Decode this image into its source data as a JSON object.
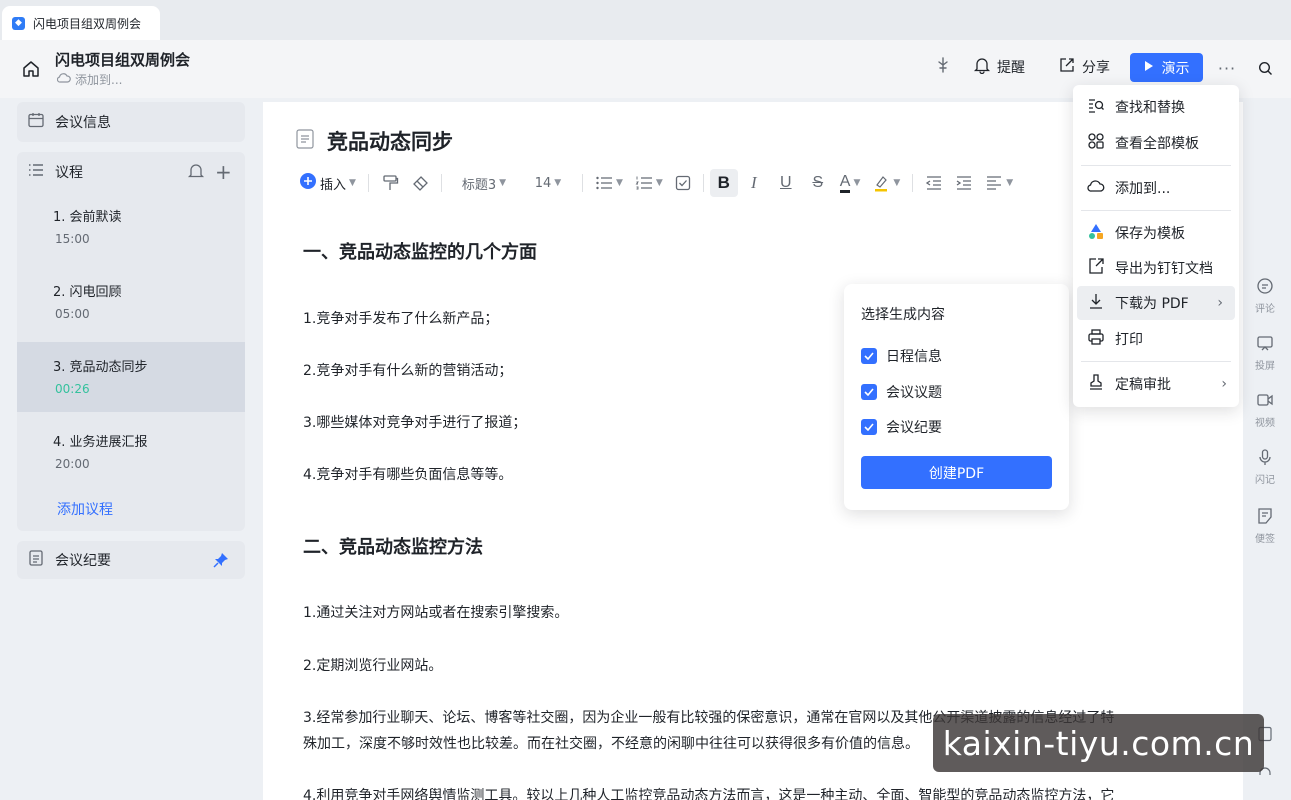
{
  "tab": {
    "title": "闪电项目组双周例会"
  },
  "header": {
    "title": "闪电项目组双周例会",
    "add_to": "添加到...",
    "remind_label": "提醒",
    "share_label": "分享",
    "present_label": "演示",
    "more_label": "···"
  },
  "sidebar": {
    "meeting_info": "会议信息",
    "agenda_title": "议程",
    "agenda": [
      {
        "label": "1. 会前默读",
        "duration": "15:00"
      },
      {
        "label": "2. 闪电回顾",
        "duration": "05:00"
      },
      {
        "label": "3. 竞品动态同步",
        "duration": "00:26",
        "active": true
      },
      {
        "label": "4. 业务进展汇报",
        "duration": "20:00"
      }
    ],
    "add_agenda": "添加议程",
    "minutes": "会议纪要"
  },
  "document": {
    "title": "竞品动态同步",
    "toolbar": {
      "insert": "插入",
      "heading": "标题3",
      "font_size": "14"
    },
    "paragraphs": [
      "一、竞品动态监控的几个方面",
      "1.竞争对手发布了什么新产品；",
      "2.竞争对手有什么新的营销活动；",
      "3.哪些媒体对竞争对手进行了报道；",
      "4.竞争对手有哪些负面信息等等。",
      "二、竞品动态监控方法",
      "1.通过关注对方网站或者在搜索引擎搜索。",
      "2.定期浏览行业网站。",
      "3.经常参加行业聊天、论坛、博客等社交圈，因为企业一般有比较强的保密意识，通常在官网以及其他公开渠道披露的信息经过了特",
      "殊加工，深度不够时效性也比较差。而在社交圈，不经意的闲聊中往往可以获得很多有价值的信息。",
      "4.利用竞争对手网络舆情监测工具。较以上几种人工监控竞品动态方法而言，这是一种主动、全面、智能型的竞品动态监控方法，它"
    ]
  },
  "pdf_popover": {
    "title": "选择生成内容",
    "options": [
      "日程信息",
      "会议议题",
      "会议纪要"
    ],
    "button": "创建PDF"
  },
  "menu": {
    "items": [
      "查找和替换",
      "查看全部模板",
      "添加到...",
      "保存为模板",
      "导出为钉钉文档",
      "下载为 PDF",
      "打印",
      "定稿审批"
    ]
  },
  "rail": {
    "comment": "评论",
    "cast": "投屏",
    "video": "视频",
    "flash": "闪记",
    "note": "便签"
  },
  "watermark": "kaixin-tiyu.com.cn",
  "colors": {
    "accent": "#3370ff",
    "active_time": "#34c19d"
  }
}
